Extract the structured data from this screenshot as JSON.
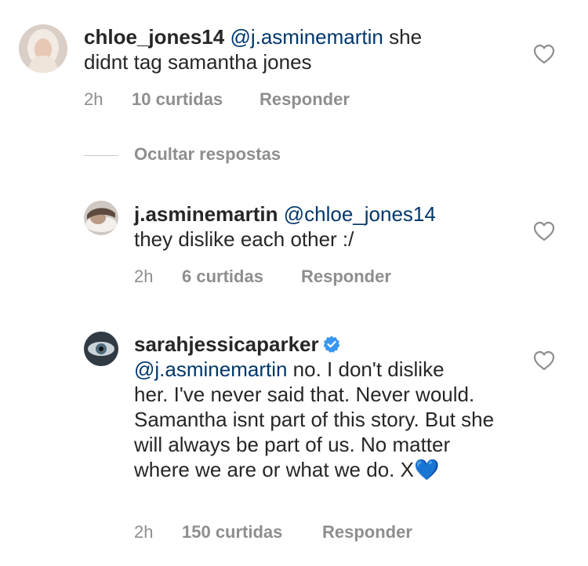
{
  "comments": [
    {
      "username": "chloe_jones14",
      "mention": "@j.asminemartin",
      "text_line1": " she",
      "text_rest": "didnt tag samantha jones",
      "time": "2h",
      "likes": "10 curtidas",
      "reply_label": "Responder"
    },
    {
      "username": "j.asminemartin",
      "mention": "@chloe_jones14",
      "text_rest": "they dislike each other :/",
      "time": "2h",
      "likes": "6 curtidas",
      "reply_label": "Responder"
    },
    {
      "username": "sarahjessicaparker",
      "verified": true,
      "mention": "@j.asminemartin",
      "text_line1": " no. I don't dislike",
      "text_rest": "her.  I've never said that. Never would. Samantha isnt part of this story. But she will always be part of us. No matter where we are or what we do. X💙",
      "time": "2h",
      "likes": "150 curtidas",
      "reply_label": "Responder"
    }
  ],
  "hide_replies_label": "Ocultar respostas",
  "icons": {
    "like": "heart-outline-icon",
    "verified": "verified-badge-icon"
  },
  "colors": {
    "text": "#262626",
    "muted": "#8e8e8e",
    "mention": "#00376b",
    "verified": "#3897f0"
  }
}
